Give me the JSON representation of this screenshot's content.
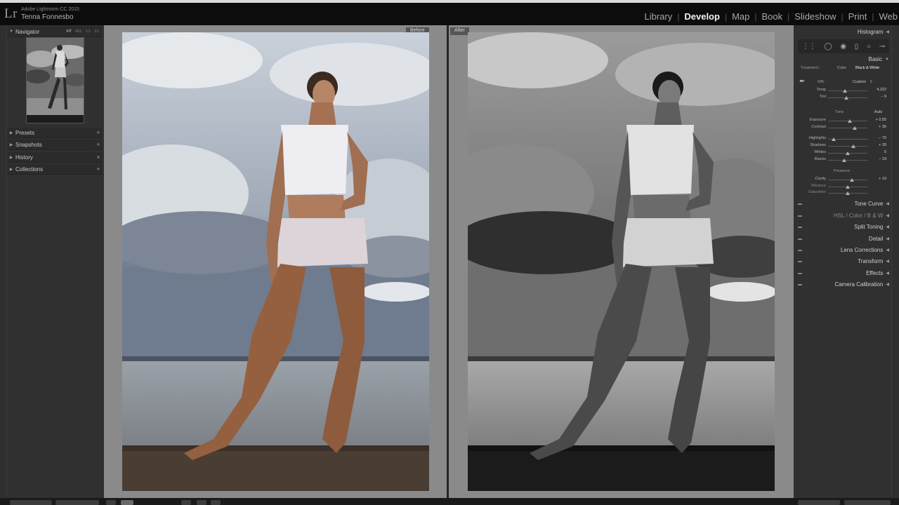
{
  "app": {
    "logo": "Lr",
    "name": "Adobe Lightroom CC 2015",
    "user": "Tenna Fonnesbo"
  },
  "modules": [
    "Library",
    "Develop",
    "Map",
    "Book",
    "Slideshow",
    "Print",
    "Web"
  ],
  "active_module": "Develop",
  "left_panel": {
    "navigator": {
      "label": "Navigator",
      "modes": [
        "FIT",
        "FILL",
        "1:1",
        "3:1"
      ]
    },
    "panels": [
      {
        "label": "Presets",
        "action": "+"
      },
      {
        "label": "Snapshots",
        "action": "+"
      },
      {
        "label": "History",
        "action": "×"
      },
      {
        "label": "Collections",
        "action": "+"
      }
    ]
  },
  "center": {
    "before_label": "Before",
    "after_label": "After"
  },
  "right_panel": {
    "histogram_label": "Histogram",
    "basic_label": "Basic",
    "treatment_label": "Treatment :",
    "treatment_options": [
      "Color",
      "Black & White"
    ],
    "treatment_selected": "Black & White",
    "wb_label": "WB :",
    "wb_value": "Custom",
    "tone_label": "Tone",
    "tone_auto": "Auto",
    "presence_label": "Presence",
    "sliders": [
      {
        "name": "Temp",
        "value": "4,222",
        "level": 0.42
      },
      {
        "name": "Tint",
        "value": "− 9",
        "level": 0.47
      },
      {
        "name": "Exposure",
        "value": "+ 0.55",
        "level": 0.55
      },
      {
        "name": "Contrast",
        "value": "+ 36",
        "level": 0.68
      },
      {
        "name": "Highlights",
        "value": "− 70",
        "level": 0.15
      },
      {
        "name": "Shadows",
        "value": "+ 28",
        "level": 0.64
      },
      {
        "name": "Whites",
        "value": "0",
        "level": 0.5
      },
      {
        "name": "Blacks",
        "value": "− 19",
        "level": 0.41
      },
      {
        "name": "Clarity",
        "value": "+ 19",
        "level": 0.6
      },
      {
        "name": "Vibrance",
        "value": "",
        "level": 0.5
      },
      {
        "name": "Saturation",
        "value": "",
        "level": 0.5
      }
    ],
    "panels": [
      "Tone Curve",
      "HSL  /  Color  /  B & W",
      "Split Toning",
      "Detail",
      "Lens Corrections",
      "Transform",
      "Effects",
      "Camera Calibration"
    ]
  },
  "colors": {
    "background": "#1e1e1e",
    "panel": "#303030",
    "active_text": "#f2f2f2"
  }
}
